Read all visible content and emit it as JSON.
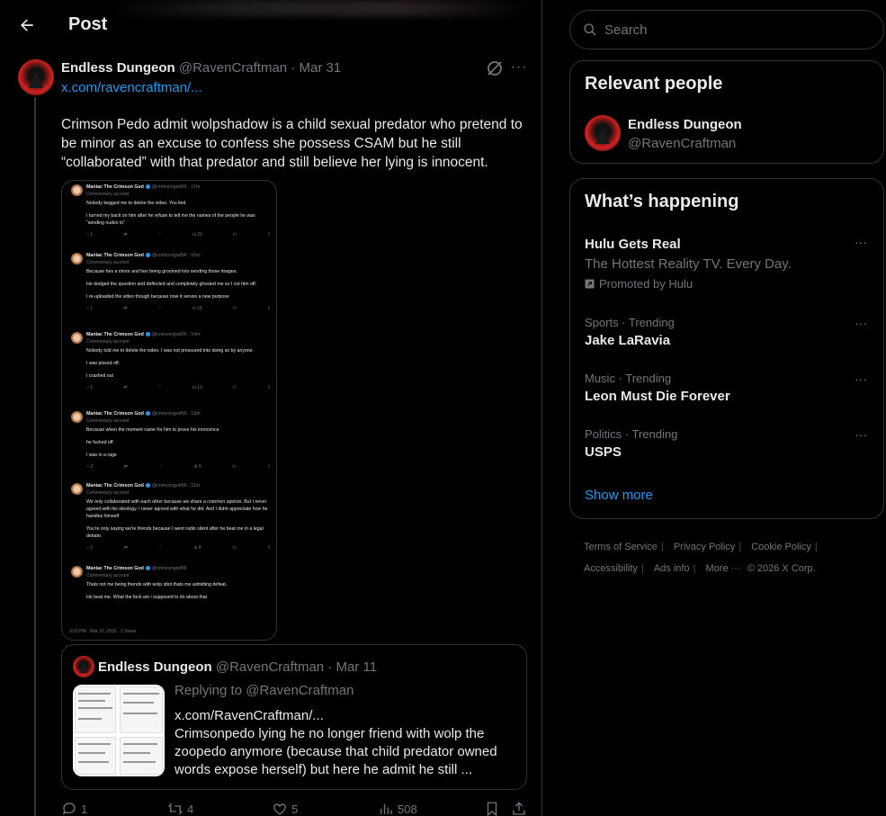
{
  "header": {
    "title": "Post"
  },
  "post": {
    "author_name": "Endless Dungeon",
    "author_handle": "@RavenCraftman",
    "date": "Mar 31",
    "link": "x.com/ravencraftman/...",
    "text": "Crimson Pedo admit wolpshadow is a child sexual predator who pretend to be minor as an excuse to confess she possess CSAM but he still “collaborated” with that predator and still believe her lying is innocent.",
    "stats": {
      "replies": "1",
      "reposts": "4",
      "likes": "5",
      "views": "508"
    }
  },
  "screenshot": {
    "items": [
      {
        "name": "Maniac The Crimson God",
        "handle": "@crimsongod56 · 17m",
        "sub": "Commentary account",
        "lines": [
          "Nobody begged me to delete the video. You lied.",
          "I turned my back on him after he refuse to tell me the names of the people he was “sending nudes to”"
        ],
        "stats": [
          "1",
          "",
          "",
          "20"
        ]
      },
      {
        "name": "Maniac The Crimson God",
        "handle": "@crimsongod56 · 15m",
        "sub": "Commentary account",
        "lines": [
          "Because hes a minor and hes being groomed into sending those images.",
          "He dodged the question and deflected and completely ghosted me so I cut him off.",
          "I re-uploaded the video though because now it serves a new purpose"
        ],
        "stats": [
          "1",
          "",
          "",
          "15"
        ]
      },
      {
        "name": "Maniac The Crimson God",
        "handle": "@crimsongod56 · 14m",
        "sub": "Commentary account",
        "lines": [
          "Nobody told me to delete the video. I was not pressured into doing so by anyone.",
          "I was pissed off.",
          "I crashed out"
        ],
        "stats": [
          "1",
          "",
          "",
          "13"
        ]
      },
      {
        "name": "Maniac The Crimson God",
        "handle": "@crimsongod56 · 13m",
        "sub": "Commentary account",
        "lines": [
          "Because when the moment came for him to prove his innocence",
          "he fucked off.",
          "I was in a rage"
        ],
        "stats": [
          "2",
          "",
          "",
          "9"
        ]
      },
      {
        "name": "Maniac The Crimson God",
        "handle": "@crimsongod56 · 11m",
        "sub": "Commentary account",
        "lines": [
          "We only collaborated with each other because we share a common opinion. But I never agreed with his ideology. I never agreed with what he did. And I didnt appreciate how he handles himself",
          "You're only saying we're friends because I went radio silent after he beat me in a legal debate."
        ],
        "stats": [
          "1",
          "",
          "",
          "8"
        ]
      },
      {
        "name": "Maniac The Crimson God",
        "handle": "@crimsongod56",
        "sub": "Commentary account",
        "lines": [
          "Thats not me being friends with wolp idiot thats me admitting defeat.",
          "He beat me. What the fuck am i supposed to do about that"
        ],
        "stats": []
      }
    ],
    "footer": "3:03 PM · Mar 31, 2025 · 2 Views"
  },
  "quote": {
    "author_name": "Endless Dungeon",
    "author_handle": "@RavenCraftman",
    "date": "Mar 11",
    "replying": "Replying to @RavenCraftman",
    "link": "x.com/RavenCraftman/...",
    "text": "Crimsonpedo lying he no longer friend with wolp the zoopedo anymore (because that child predator owned words expose herself) but here he admit he still ..."
  },
  "search": {
    "placeholder": "Search"
  },
  "relevant": {
    "title": "Relevant people",
    "name": "Endless Dungeon",
    "handle": "@RavenCraftman"
  },
  "trends": {
    "title": "What’s happening",
    "promo": {
      "name": "Hulu Gets Real",
      "subtitle": "The Hottest Reality TV. Every Day.",
      "by": "Promoted by Hulu"
    },
    "items": [
      {
        "context": "Sports · Trending",
        "name": "Jake LaRavia"
      },
      {
        "context": "Music · Trending",
        "name": "Leon Must Die Forever"
      },
      {
        "context": "Politics · Trending",
        "name": "USPS"
      }
    ],
    "show_more": "Show more"
  },
  "footer": {
    "links": [
      "Terms of Service",
      "Privacy Policy",
      "Cookie Policy",
      "Accessibility",
      "Ads info",
      "More ···"
    ],
    "copyright": "© 2026 X Corp."
  }
}
